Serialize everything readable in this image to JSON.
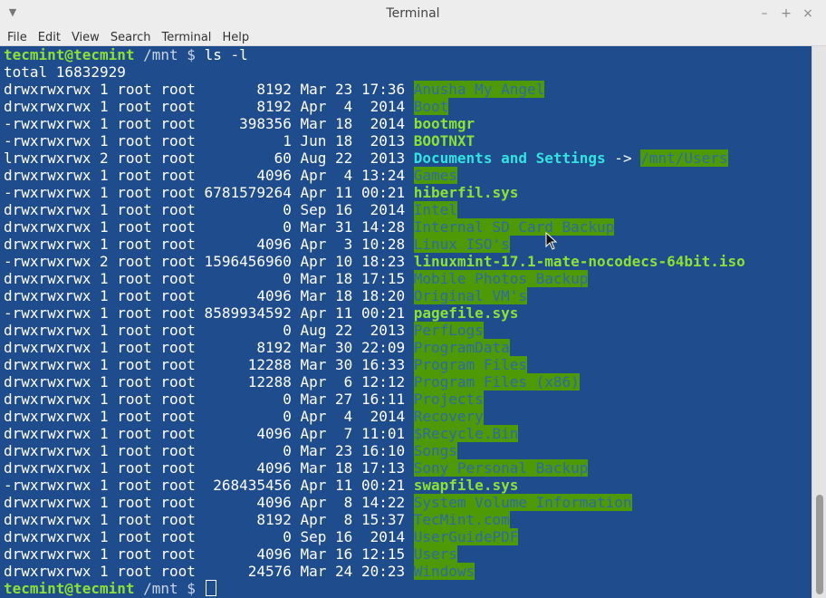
{
  "window": {
    "title": "Terminal"
  },
  "window_controls": {
    "minimize": "–",
    "maximize": "+",
    "close": "×"
  },
  "menubar": [
    "File",
    "Edit",
    "View",
    "Search",
    "Terminal",
    "Help"
  ],
  "prompt": {
    "user": "tecmint@tecmint",
    "path": " /mnt $ ",
    "command": "ls -l"
  },
  "total_line": "total 16832929",
  "entries": [
    {
      "meta": "drwxrwxrwx 1 root root       8192 Mar 23 17:36 ",
      "name": "Anusha My Angel",
      "style": "hl"
    },
    {
      "meta": "drwxrwxrwx 1 root root       8192 Apr  4  2014 ",
      "name": "Boot",
      "style": "hl"
    },
    {
      "meta": "-rwxrwxrwx 1 root root     398356 Mar 18  2014 ",
      "name": "bootmgr",
      "style": "exe"
    },
    {
      "meta": "-rwxrwxrwx 1 root root          1 Jun 18  2013 ",
      "name": "BOOTNXT",
      "style": "exe"
    },
    {
      "meta": "lrwxrwxrwx 2 root root         60 Aug 22  2013 ",
      "name": "Documents and Settings",
      "style": "lnk",
      "arrow": " -> ",
      "target": "/mnt/Users"
    },
    {
      "meta": "drwxrwxrwx 1 root root       4096 Apr  4 13:24 ",
      "name": "Games",
      "style": "hl"
    },
    {
      "meta": "-rwxrwxrwx 1 root root 6781579264 Apr 11 00:21 ",
      "name": "hiberfil.sys",
      "style": "exe"
    },
    {
      "meta": "drwxrwxrwx 1 root root          0 Sep 16  2014 ",
      "name": "Intel",
      "style": "hl"
    },
    {
      "meta": "drwxrwxrwx 1 root root          0 Mar 31 14:28 ",
      "name": "Internal SD Card Backup",
      "style": "hl"
    },
    {
      "meta": "drwxrwxrwx 1 root root       4096 Apr  3 10:28 ",
      "name": "Linux ISO's",
      "style": "hl"
    },
    {
      "meta": "-rwxrwxrwx 2 root root 1596456960 Apr 10 18:23 ",
      "name": "linuxmint-17.1-mate-nocodecs-64bit.iso",
      "style": "exe"
    },
    {
      "meta": "drwxrwxrwx 1 root root          0 Mar 18 17:15 ",
      "name": "Mobile Photos Backup",
      "style": "hl"
    },
    {
      "meta": "drwxrwxrwx 1 root root       4096 Mar 18 18:20 ",
      "name": "Original VM's",
      "style": "hl"
    },
    {
      "meta": "-rwxrwxrwx 1 root root 8589934592 Apr 11 00:21 ",
      "name": "pagefile.sys",
      "style": "exe"
    },
    {
      "meta": "drwxrwxrwx 1 root root          0 Aug 22  2013 ",
      "name": "PerfLogs",
      "style": "hl"
    },
    {
      "meta": "drwxrwxrwx 1 root root       8192 Mar 30 22:09 ",
      "name": "ProgramData",
      "style": "hl"
    },
    {
      "meta": "drwxrwxrwx 1 root root      12288 Mar 30 16:33 ",
      "name": "Program Files",
      "style": "hl"
    },
    {
      "meta": "drwxrwxrwx 1 root root      12288 Apr  6 12:12 ",
      "name": "Program Files (x86)",
      "style": "hl"
    },
    {
      "meta": "drwxrwxrwx 1 root root          0 Mar 27 16:11 ",
      "name": "Projects",
      "style": "hl"
    },
    {
      "meta": "drwxrwxrwx 1 root root          0 Apr  4  2014 ",
      "name": "Recovery",
      "style": "hl"
    },
    {
      "meta": "drwxrwxrwx 1 root root       4096 Apr  7 11:01 ",
      "name": "$Recycle.Bin",
      "style": "hl"
    },
    {
      "meta": "drwxrwxrwx 1 root root          0 Mar 23 16:10 ",
      "name": "Songs",
      "style": "hl"
    },
    {
      "meta": "drwxrwxrwx 1 root root       4096 Mar 18 17:13 ",
      "name": "Sony Personal Backup",
      "style": "hl"
    },
    {
      "meta": "-rwxrwxrwx 1 root root  268435456 Apr 11 00:21 ",
      "name": "swapfile.sys",
      "style": "exe"
    },
    {
      "meta": "drwxrwxrwx 1 root root       4096 Apr  8 14:22 ",
      "name": "System Volume Information",
      "style": "hl"
    },
    {
      "meta": "drwxrwxrwx 1 root root       8192 Apr  8 15:37 ",
      "name": "TecMint.com",
      "style": "hl"
    },
    {
      "meta": "drwxrwxrwx 1 root root          0 Sep 16  2014 ",
      "name": "UserGuidePDF",
      "style": "hl"
    },
    {
      "meta": "drwxrwxrwx 1 root root       4096 Mar 16 12:15 ",
      "name": "Users",
      "style": "hl"
    },
    {
      "meta": "drwxrwxrwx 1 root root      24576 Mar 24 20:23 ",
      "name": "Windows",
      "style": "hl"
    }
  ],
  "final_prompt": {
    "user": "tecmint@tecmint",
    "path": " /mnt $ "
  }
}
